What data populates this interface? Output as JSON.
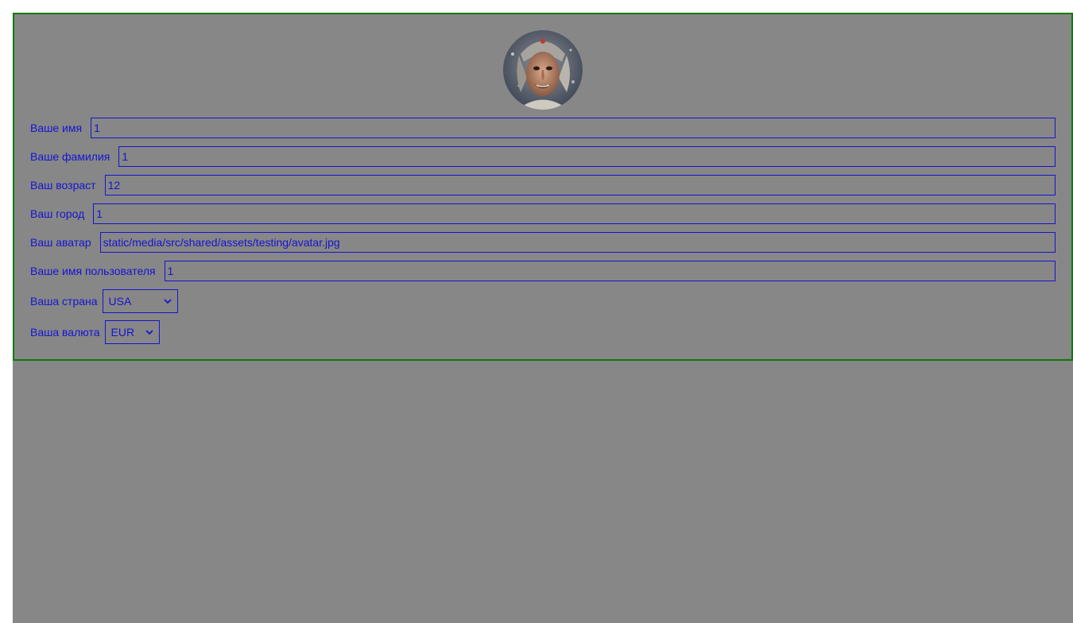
{
  "profile": {
    "avatar_alt": "avatar",
    "fields": {
      "first_name": {
        "label": "Ваше имя",
        "value": "1"
      },
      "last_name": {
        "label": "Ваше фамилия",
        "value": "1"
      },
      "age": {
        "label": "Ваш возраст",
        "value": "12"
      },
      "city": {
        "label": "Ваш город",
        "value": "1"
      },
      "avatar": {
        "label": "Ваш аватар",
        "value": "static/media/src/shared/assets/testing/avatar.jpg"
      },
      "username": {
        "label": "Ваше имя пользователя",
        "value": "1"
      }
    },
    "country": {
      "label": "Ваша страна",
      "selected": "USA"
    },
    "currency": {
      "label": "Ваша валюта",
      "selected": "EUR"
    }
  },
  "colors": {
    "page_background": "#878787",
    "card_border": "#0b7a0b",
    "text_accent": "#1414d2"
  }
}
